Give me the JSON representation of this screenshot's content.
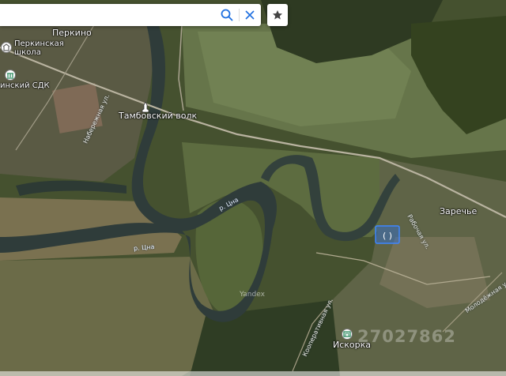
{
  "search": {
    "placeholder": "",
    "value": ""
  },
  "toolbar": {
    "search_icon": "search-icon",
    "clear_icon": "close-icon",
    "bookmark_icon": "star-icon"
  },
  "map": {
    "places": {
      "perkino": "Перкино",
      "school_line1": "Перкинская",
      "school_line2": "школа",
      "sdk": "инский СДК",
      "wolf": "Тамбовский волк",
      "zarechye": "Заречье",
      "iskorka": "Искорка"
    },
    "rivers": {
      "tsna_1": "р. Цна",
      "tsna_2": "р. Цна"
    },
    "streets": {
      "naberezhnaya": "Набережная ул.",
      "rabochaya": "Рабочая ул.",
      "molodezhnaya": "Молодёжная ул.",
      "kooperativnaya": "Кооперативная ул."
    },
    "watermarks": {
      "yandex": "Yandex",
      "cian_number": "27027862"
    },
    "colors": {
      "river": "#2f3c3a",
      "field": "#6b7a4d",
      "marker": "#2f6fd6"
    }
  }
}
